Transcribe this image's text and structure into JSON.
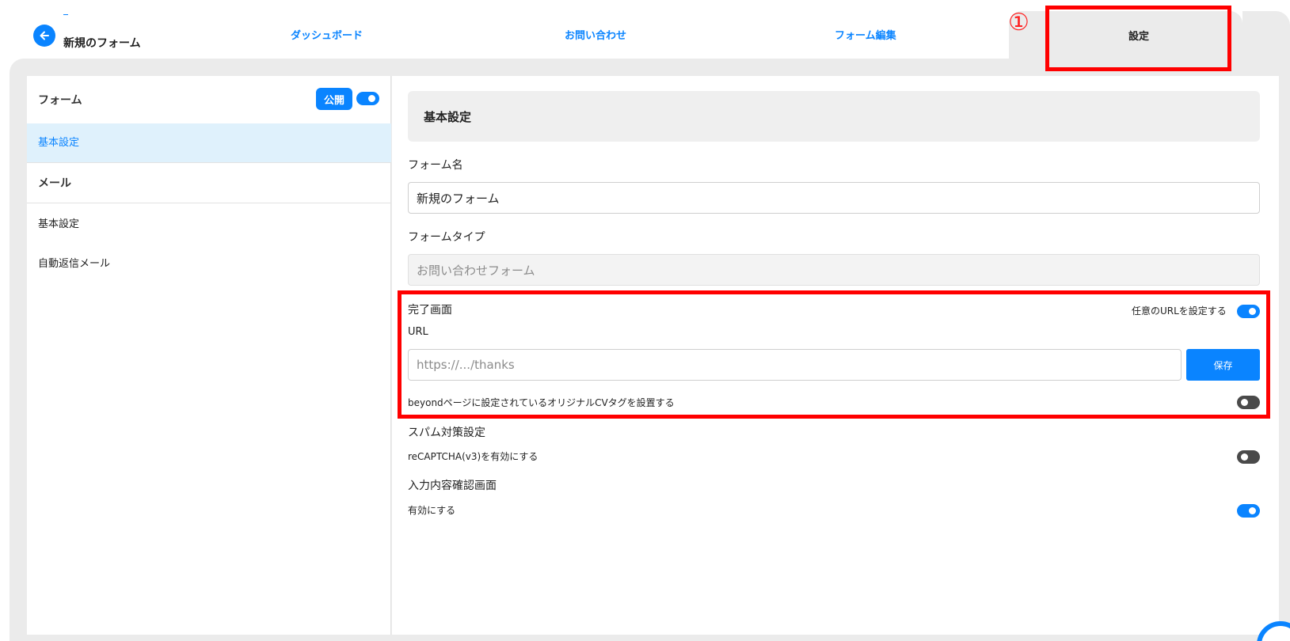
{
  "header": {
    "form_title": "新規のフォーム",
    "tabs": [
      {
        "label": "ダッシュボード"
      },
      {
        "label": "お問い合わせ"
      },
      {
        "label": "フォーム編集"
      },
      {
        "label": "設定"
      }
    ],
    "annotation_number": "①"
  },
  "sidebar": {
    "form_label": "フォーム",
    "publish_label": "公開",
    "publish_toggle": "on",
    "items": [
      {
        "label": "基本設定"
      },
      {
        "label": "メール"
      },
      {
        "label": "基本設定"
      },
      {
        "label": "自動返信メール"
      }
    ]
  },
  "content": {
    "section_title": "基本設定",
    "form_name_label": "フォーム名",
    "form_name_value": "新規のフォーム",
    "form_type_label": "フォームタイプ",
    "form_type_value": "お問い合わせフォーム",
    "completion": {
      "title": "完了画面",
      "custom_url_label": "任意のURLを設定する",
      "custom_url_toggle": "on",
      "url_label": "URL",
      "url_placeholder": "https://.../thanks",
      "save_label": "保存",
      "cv_tag_label": "beyondページに設定されているオリジナルCVタグを設置する",
      "cv_tag_toggle": "off"
    },
    "spam": {
      "title": "スパム対策設定",
      "recaptcha_label": "reCAPTCHA(v3)を有効にする",
      "recaptcha_toggle": "off"
    },
    "confirm": {
      "title": "入力内容確認画面",
      "enable_label": "有効にする",
      "enable_toggle": "on"
    }
  },
  "colors": {
    "accent": "#0a84ff",
    "annotation": "#ff0000",
    "frame": "#ebebeb"
  }
}
